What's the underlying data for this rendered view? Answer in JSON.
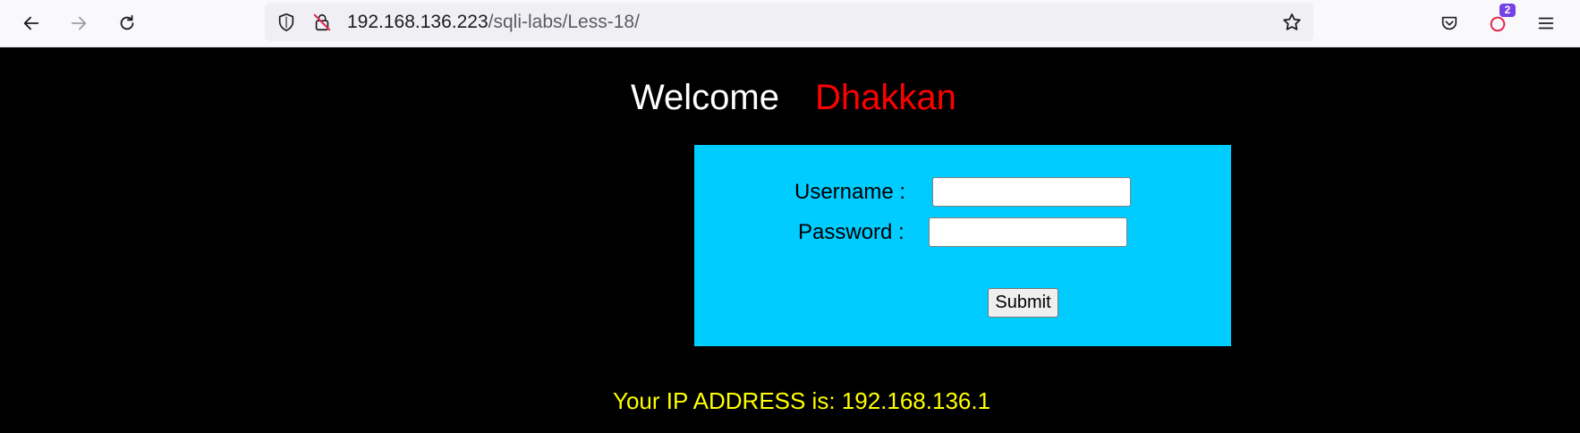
{
  "browser": {
    "url_host": "192.168.136.223",
    "url_path": "/sqli-labs/Less-18/",
    "notification_count": "2",
    "icons": [
      "back-icon",
      "forward-icon",
      "reload-icon",
      "shield-icon",
      "insecure-lock-icon",
      "bookmark-star-icon",
      "pocket-icon",
      "account-icon",
      "menu-icon"
    ]
  },
  "page": {
    "welcome_text": "Welcome",
    "name_text": "Dhakkan",
    "username_label": "Username :",
    "password_label": "Password :",
    "username_value": "",
    "password_value": "",
    "submit_label": "Submit",
    "ip_text": "Your IP ADDRESS is: 192.168.136.1"
  },
  "colors": {
    "background": "#000000",
    "welcome": "#ffffff",
    "name": "#ff0000",
    "login_box": "#00ccff",
    "ip_text": "#ffff00"
  }
}
